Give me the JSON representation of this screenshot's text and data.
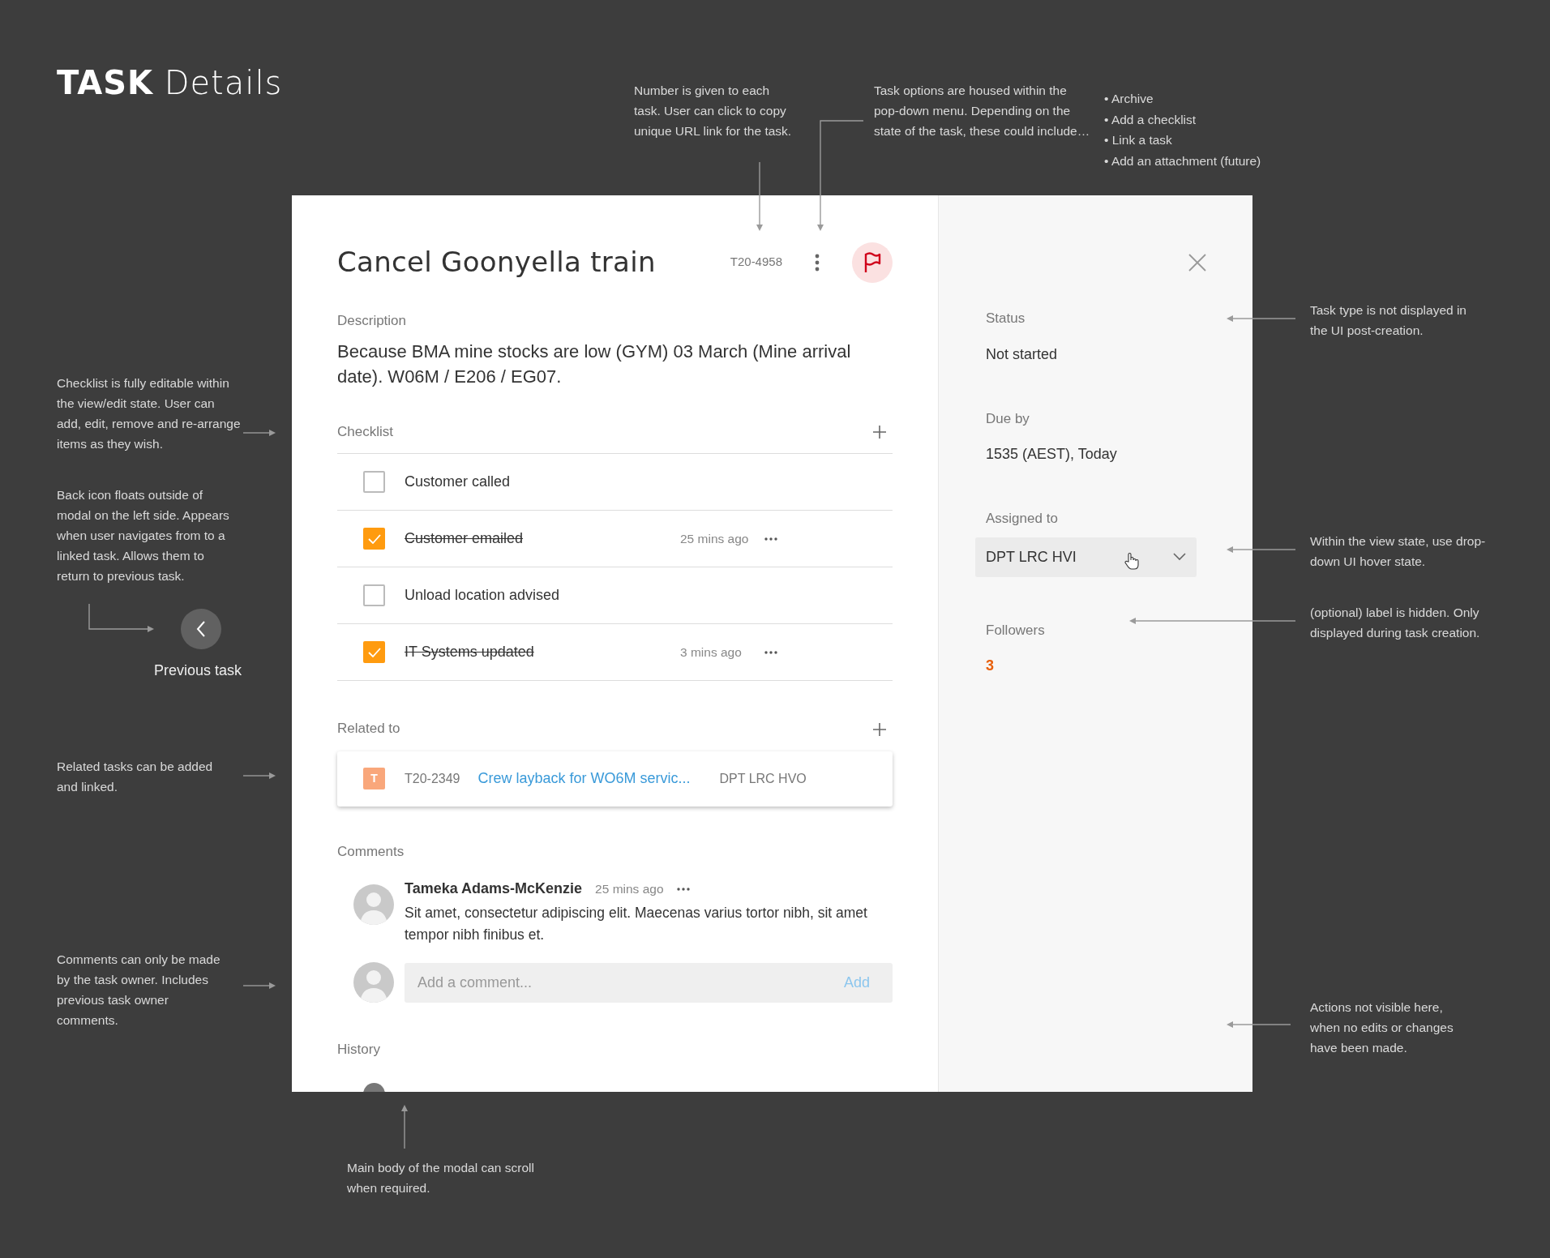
{
  "page_title": "**TASK** Details",
  "annotations": [
    {
      "lines": [
        "Number is given to each",
        "task. User can click to copy",
        "unique URL link for the task."
      ]
    },
    {
      "lines": [
        "Task options are housed within the",
        "pop-down menu. Depending on the",
        "state of the task, these could include…"
      ]
    },
    {
      "lines": [
        "Checklist is fully editable within",
        "the view/edit state. User can",
        "add, edit, remove and re-arrange",
        "items as they wish."
      ]
    },
    {
      "lines": [
        "Back icon floats outside of",
        "modal on the left side. Appears",
        "when user navigates from to a",
        "linked task. Allows them to",
        "return to previous task."
      ]
    },
    {
      "lines": [
        "Related tasks can be added",
        "and linked."
      ]
    },
    {
      "lines": [
        "Comments can only be made",
        "by the task owner. Includes",
        "previous task owner",
        "comments."
      ]
    },
    {
      "lines": [
        "Main body of the modal can scroll",
        "when required."
      ]
    },
    {
      "lines": [
        "Task type is not displayed in",
        "the UI post-creation."
      ]
    },
    {
      "lines": [
        "Within the view state, use drop-",
        "down UI hover state."
      ]
    },
    {
      "lines": [
        "(optional) label is hidden. Only",
        "displayed during task creation."
      ]
    },
    {
      "lines": [
        "Actions not visible here,",
        "when no edits or changes",
        "have been made."
      ]
    }
  ],
  "options_list": [
    "• Archive",
    "• Add a checklist",
    "• Link a task",
    "• Add an attachment (future)"
  ],
  "back_button": {
    "label": "Previous task"
  },
  "modal": {
    "title": "Cancel Goonyella train",
    "task_number": "T20-4958",
    "flagged": true,
    "description_label": "Description",
    "description": "Because BMA mine stocks are low (GYM) 03 March (Mine arrival date). W06M / E206 / EG07.",
    "checklist": {
      "label": "Checklist",
      "items": [
        {
          "text": "Customer called",
          "checked": false
        },
        {
          "text": "Customer emailed",
          "checked": true,
          "time": "25 mins ago"
        },
        {
          "text": "Unload location advised",
          "checked": false
        },
        {
          "text": "IT Systems updated",
          "checked": true,
          "time": "3 mins ago"
        }
      ]
    },
    "related": {
      "label": "Related to",
      "items": [
        {
          "type_letter": "T",
          "number": "T20-2349",
          "title": "Crew layback for WO6M servic...",
          "assignee": "DPT LRC HVO"
        }
      ]
    },
    "comments": {
      "label": "Comments",
      "items": [
        {
          "author": "Tameka Adams-McKenzie",
          "time": "25 mins ago",
          "text": "Sit amet, consectetur adipiscing elit. Maecenas varius tortor nibh, sit amet tempor nibh finibus et."
        }
      ],
      "input": {
        "placeholder": "Add a comment...",
        "button": "Add"
      }
    },
    "history": {
      "label": "History"
    }
  },
  "side_panel": {
    "fields": [
      {
        "kind": "text",
        "label": "Status",
        "value": "Not started"
      },
      {
        "kind": "text",
        "label": "Due by",
        "value": "1535 (AEST), Today"
      },
      {
        "kind": "dropdown",
        "label": "Assigned to",
        "value": "DPT LRC HVI"
      },
      {
        "kind": "count",
        "label": "Followers",
        "value": "3"
      }
    ]
  }
}
